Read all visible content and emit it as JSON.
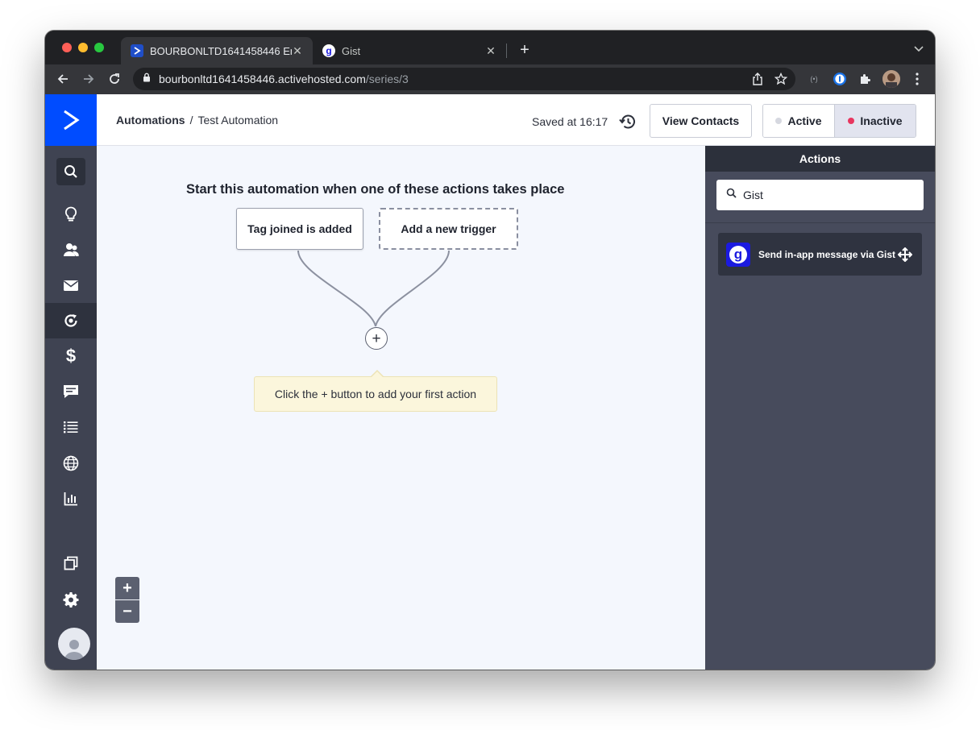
{
  "browser": {
    "tabs": [
      {
        "title": "BOURBONLTD1641458446 Em",
        "active": true,
        "favicon": "activecampaign-icon"
      },
      {
        "title": "Gist",
        "active": false,
        "favicon": "gist-icon"
      }
    ],
    "url": {
      "host": "bourbonltd1641458446.activehosted.com",
      "path": "/series/3"
    }
  },
  "header": {
    "breadcrumb_root": "Automations",
    "breadcrumb_sep": "/",
    "breadcrumb_current": "Test Automation",
    "saved_text": "Saved at 16:17",
    "view_contacts_label": "View Contacts",
    "status": {
      "active_label": "Active",
      "inactive_label": "Inactive",
      "selected": "Inactive"
    }
  },
  "canvas": {
    "title": "Start this automation when one of these actions takes place",
    "triggers": [
      "Tag joined is added",
      "Add a new trigger"
    ],
    "add_button": "+",
    "tooltip": "Click the + button to add your first action",
    "zoom_in": "+",
    "zoom_out": "−"
  },
  "panel": {
    "title": "Actions",
    "search_value": "Gist",
    "action_item": "Send in-app message via Gist"
  },
  "colors": {
    "brand_blue": "#004cff",
    "inactive_dot": "#e8365f",
    "active_dot": "#d6d8e0",
    "gist_blue": "#1b1ae0"
  }
}
